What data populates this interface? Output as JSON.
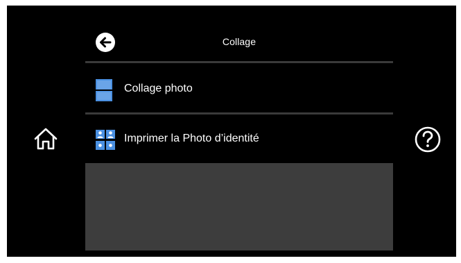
{
  "header": {
    "title": "Collage",
    "back_icon": "back-arrow-icon"
  },
  "menu": {
    "items": [
      {
        "label": "Collage photo",
        "icon": "collage-photo-icon"
      },
      {
        "label": "Imprimer la Photo d’identité",
        "icon": "id-photo-icon"
      }
    ]
  },
  "side": {
    "home_icon": "home-icon",
    "help_icon": "help-icon"
  },
  "colors": {
    "background": "#000000",
    "accent": "#4a90e2",
    "divider": "#3a3a3a",
    "panel": "#3d3d3d",
    "text": "#ffffff"
  }
}
